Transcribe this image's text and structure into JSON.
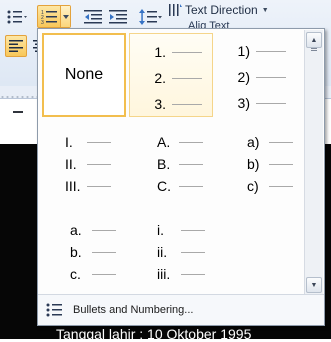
{
  "ribbon": {
    "text_direction_label": "Text Direction",
    "second_row_stub": "Alig Text"
  },
  "gallery": {
    "none_label": "None",
    "cells": [
      {
        "id": "numbers-dot",
        "items": [
          "1.",
          "2.",
          "3."
        ],
        "highlighted": true
      },
      {
        "id": "numbers-paren",
        "items": [
          "1)",
          "2)",
          "3)"
        ],
        "highlighted": false
      },
      {
        "id": "roman-upper",
        "items": [
          "I.",
          "II.",
          "III."
        ],
        "highlighted": false
      },
      {
        "id": "alpha-upper",
        "items": [
          "A.",
          "B.",
          "C."
        ],
        "highlighted": false
      },
      {
        "id": "alpha-lower-paren",
        "items": [
          "a)",
          "b)",
          "c)"
        ],
        "highlighted": false
      },
      {
        "id": "alpha-lower-dot",
        "items": [
          "a.",
          "b.",
          "c."
        ],
        "highlighted": false
      },
      {
        "id": "roman-lower",
        "items": [
          "i.",
          "ii.",
          "iii."
        ],
        "highlighted": false
      }
    ],
    "footer_label": "Bullets and Numbering..."
  },
  "document": {
    "visible_text": "Tanggal lahir : 10 Oktober 1995"
  },
  "colors": {
    "selection_border": "#f2be4e",
    "hover_border": "#f5d58a",
    "ribbon_active": "#f8c759"
  }
}
